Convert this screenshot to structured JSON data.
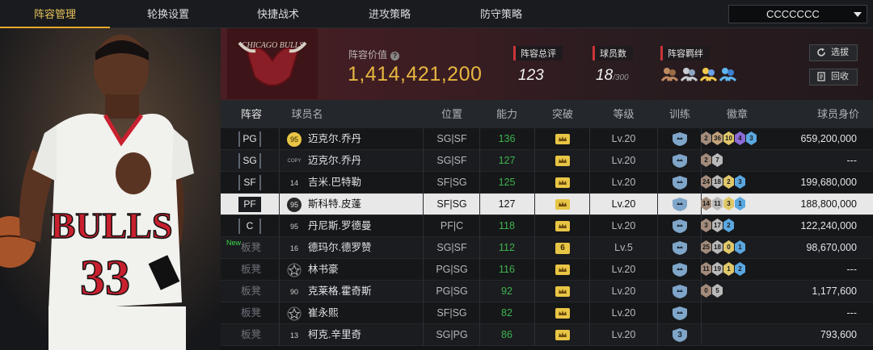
{
  "nav": {
    "tabs": [
      "阵容管理",
      "轮换设置",
      "快捷战术",
      "进攻策略",
      "防守策略"
    ],
    "active_index": 0,
    "team_select": "CCCCCCC"
  },
  "banner": {
    "logo_text": "CHICAGO BULLS",
    "value_label": "阵容价值",
    "value": "1,414,421,200",
    "stats": {
      "rating_label": "阵容总评",
      "rating": "123",
      "players_label": "球员数",
      "players": "18",
      "players_max": "/300",
      "bond_label": "阵容羁绊"
    },
    "buttons": {
      "select": "选拔",
      "recycle": "回收"
    }
  },
  "table": {
    "headers": [
      "阵容",
      "球员名",
      "位置",
      "能力",
      "突破",
      "等级",
      "训练",
      "徽章",
      "球员身价"
    ],
    "rows": [
      {
        "slot": "PG",
        "bench": false,
        "new": false,
        "number": "95",
        "name": "迈克尔.乔丹",
        "positions": "SG|SF",
        "ability": "136",
        "break": "crown",
        "level": "Lv.20",
        "train": "",
        "medals": [
          [
            "2",
            "#a28b7b"
          ],
          [
            "36",
            "#c2a27b"
          ],
          [
            "10",
            "#e0c86a"
          ],
          [
            "4",
            "#8c6bd6"
          ],
          [
            "3",
            "#5aa7e0"
          ]
        ],
        "value": "659,200,000"
      },
      {
        "slot": "SG",
        "bench": false,
        "new": false,
        "number": "COPY",
        "name": "迈克尔.乔丹",
        "positions": "SG|SF",
        "ability": "127",
        "break": "crown",
        "level": "Lv.20",
        "train": "",
        "medals": [
          [
            "2",
            "#a28b7b"
          ],
          [
            "7",
            "#b9b9b9"
          ]
        ],
        "value": "---"
      },
      {
        "slot": "SF",
        "bench": false,
        "new": false,
        "number": "14",
        "name": "吉米.巴特勒",
        "positions": "SF|SG",
        "ability": "125",
        "break": "crown",
        "level": "Lv.20",
        "train": "",
        "medals": [
          [
            "24",
            "#a28b7b"
          ],
          [
            "18",
            "#b9b9b9"
          ],
          [
            "2",
            "#e0c86a"
          ],
          [
            "3",
            "#5aa7e0"
          ]
        ],
        "value": "199,680,000"
      },
      {
        "slot": "PF",
        "bench": false,
        "new": false,
        "number": "95",
        "name": "斯科特.皮蓬",
        "positions": "SF|SG",
        "ability": "127",
        "break": "crown",
        "level": "Lv.20",
        "train": "",
        "medals": [
          [
            "14",
            "#a28b7b"
          ],
          [
            "11",
            "#b9b9b9"
          ],
          [
            "3",
            "#e0c86a"
          ],
          [
            "1",
            "#5aa7e0"
          ]
        ],
        "value": "188,800,000",
        "selected": true
      },
      {
        "slot": "C",
        "bench": false,
        "new": false,
        "number": "95",
        "name": "丹尼斯.罗德曼",
        "positions": "PF|C",
        "ability": "118",
        "break": "crown",
        "level": "Lv.20",
        "train": "",
        "medals": [
          [
            "3",
            "#a28b7b"
          ],
          [
            "17",
            "#b9b9b9"
          ],
          [
            "2",
            "#5aa7e0"
          ]
        ],
        "value": "122,240,000"
      },
      {
        "slot": "板凳",
        "bench": true,
        "new": true,
        "new_label": "New",
        "number": "16",
        "name": "德玛尔.德罗赞",
        "positions": "SG|SF",
        "ability": "112",
        "break": "6",
        "level": "Lv.5",
        "train": "",
        "medals": [
          [
            "25",
            "#a28b7b"
          ],
          [
            "18",
            "#b9b9b9"
          ],
          [
            "0",
            "#e0c86a"
          ],
          [
            "1",
            "#5aa7e0"
          ]
        ],
        "value": "98,670,000"
      },
      {
        "slot": "板凳",
        "bench": true,
        "new": false,
        "number": "star",
        "name": "林书豪",
        "positions": "PG|SG",
        "ability": "116",
        "break": "crown",
        "level": "Lv.20",
        "train": "",
        "medals": [
          [
            "11",
            "#a28b7b"
          ],
          [
            "19",
            "#b9b9b9"
          ],
          [
            "1",
            "#e0c86a"
          ],
          [
            "2",
            "#5aa7e0"
          ]
        ],
        "value": "---"
      },
      {
        "slot": "板凳",
        "bench": true,
        "new": false,
        "number": "90",
        "name": "克莱格.霍奇斯",
        "positions": "PG|SG",
        "ability": "92",
        "break": "crown",
        "level": "Lv.20",
        "train": "",
        "medals": [
          [
            "0",
            "#a28b7b"
          ],
          [
            "5",
            "#b9b9b9"
          ]
        ],
        "value": "1,177,600"
      },
      {
        "slot": "板凳",
        "bench": true,
        "new": false,
        "number": "star",
        "name": "崔永熙",
        "positions": "SF|SG",
        "ability": "82",
        "break": "crown",
        "level": "Lv.20",
        "train": "",
        "medals": [],
        "value": "---"
      },
      {
        "slot": "板凳",
        "bench": true,
        "new": false,
        "number": "13",
        "name": "柯克.辛里奇",
        "positions": "SG|PG",
        "ability": "86",
        "break": "crown",
        "level": "Lv.20",
        "train": "3",
        "medals": [],
        "value": "793,600"
      }
    ]
  },
  "colors": {
    "gold": "#e7b640",
    "accent_red": "#c8353a",
    "green": "#3eb44f",
    "selected_row": "#e8e8e8"
  }
}
